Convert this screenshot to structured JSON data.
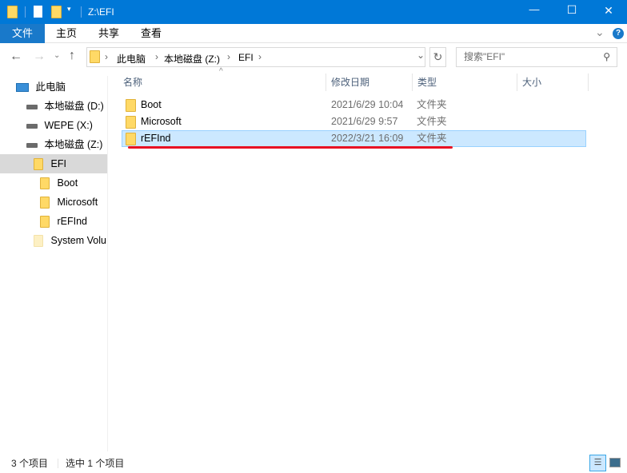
{
  "window": {
    "title": "Z:\\EFI",
    "min": "—",
    "max": "☐",
    "close": "✕"
  },
  "ribbon": {
    "tabs": [
      "文件",
      "主页",
      "共享",
      "查看"
    ],
    "expand": "⌄",
    "help": "?"
  },
  "address": {
    "crumbs": [
      "此电脑",
      "本地磁盘 (Z:)",
      "EFI"
    ],
    "search_placeholder": "搜索\"EFI\""
  },
  "nav": {
    "items": [
      {
        "label": "此电脑",
        "type": "pc"
      },
      {
        "label": "本地磁盘 (D:)",
        "type": "drive"
      },
      {
        "label": "WEPE (X:)",
        "type": "drive"
      },
      {
        "label": "本地磁盘 (Z:)",
        "type": "drive"
      },
      {
        "label": "EFI",
        "type": "folder",
        "selected": true
      },
      {
        "label": "Boot",
        "type": "folder"
      },
      {
        "label": "Microsoft",
        "type": "folder"
      },
      {
        "label": "rEFInd",
        "type": "folder"
      },
      {
        "label": "System Volu",
        "type": "folder-faded"
      }
    ]
  },
  "columns": [
    "名称",
    "修改日期",
    "类型",
    "大小"
  ],
  "files": [
    {
      "name": "Boot",
      "date": "2021/6/29 10:04",
      "type": "文件夹",
      "size": ""
    },
    {
      "name": "Microsoft",
      "date": "2021/6/29 9:57",
      "type": "文件夹",
      "size": ""
    },
    {
      "name": "rEFInd",
      "date": "2022/3/21 16:09",
      "type": "文件夹",
      "size": "",
      "selected": true
    }
  ],
  "status": {
    "count": "3 个项目",
    "selected": "选中 1 个项目"
  },
  "colors": {
    "accent": "#0078d7",
    "selection": "#cce8ff",
    "annotation": "#e81123"
  }
}
